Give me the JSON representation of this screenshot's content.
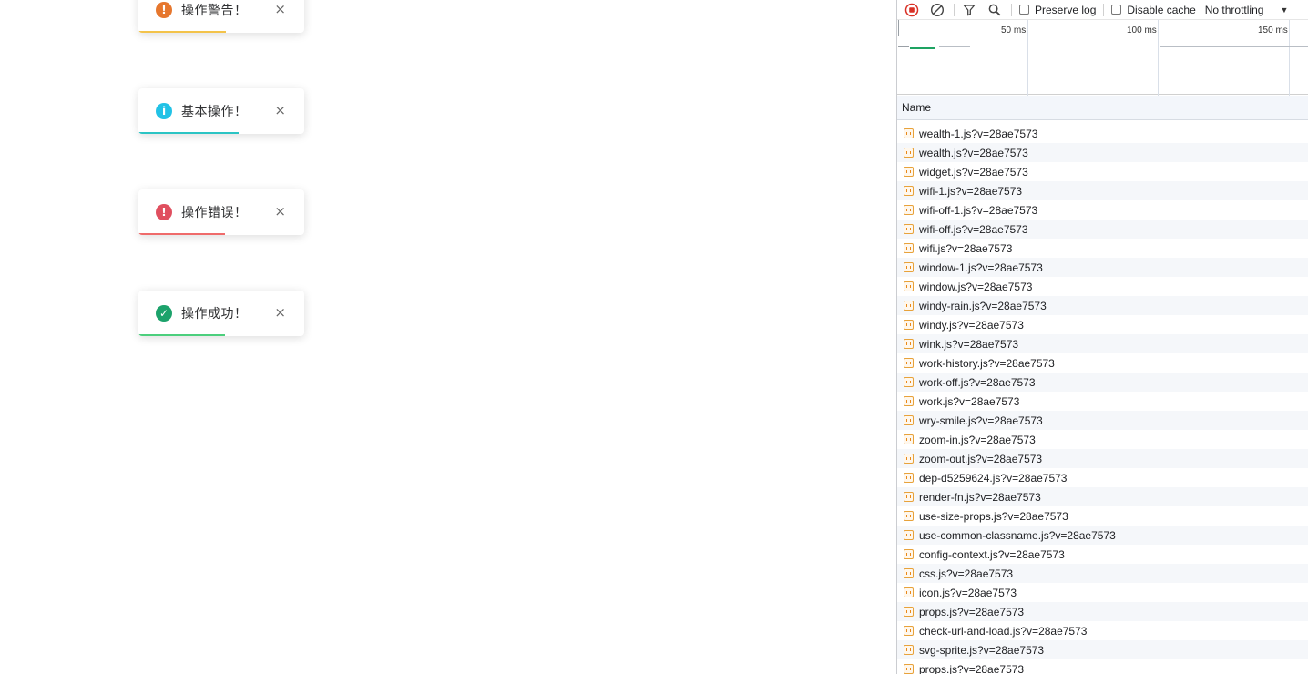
{
  "toasts": [
    {
      "text": "操作警告！",
      "type": "warning",
      "color": "#e6772e",
      "bar_color": "#f3c34a",
      "glyph": "!",
      "icon": "warning-icon",
      "progress_percent": 52
    },
    {
      "text": "基本操作！",
      "type": "info",
      "color": "#22c2e6",
      "bar_color": "#2bc4c4",
      "glyph": "i",
      "icon": "info-icon",
      "progress_percent": 60
    },
    {
      "text": "操作错误！",
      "type": "error",
      "color": "#e04f5f",
      "bar_color": "#ef6b6b",
      "glyph": "!",
      "icon": "error-icon",
      "progress_percent": 52
    },
    {
      "text": "操作成功！",
      "type": "success",
      "color": "#1ca26b",
      "bar_color": "#4ccf7d",
      "glyph": "✓",
      "icon": "success-icon",
      "progress_percent": 52
    }
  ],
  "toast_close": "×",
  "devtools": {
    "toolbar": {
      "record_icon": "record-stop-icon",
      "clear_icon": "clear-icon",
      "filter_icon": "filter-icon",
      "search_icon": "search-icon",
      "preserve_log": "Preserve log",
      "disable_cache": "Disable cache",
      "throttling": "No throttling",
      "throttle_caret": "▼"
    },
    "timeline": {
      "labels": [
        "50 ms",
        "100 ms",
        "150 ms"
      ]
    },
    "column_name": "Name",
    "files": [
      "wealth-1.js?v=28ae7573",
      "wealth.js?v=28ae7573",
      "widget.js?v=28ae7573",
      "wifi-1.js?v=28ae7573",
      "wifi-off-1.js?v=28ae7573",
      "wifi-off.js?v=28ae7573",
      "wifi.js?v=28ae7573",
      "window-1.js?v=28ae7573",
      "window.js?v=28ae7573",
      "windy-rain.js?v=28ae7573",
      "windy.js?v=28ae7573",
      "wink.js?v=28ae7573",
      "work-history.js?v=28ae7573",
      "work-off.js?v=28ae7573",
      "work.js?v=28ae7573",
      "wry-smile.js?v=28ae7573",
      "zoom-in.js?v=28ae7573",
      "zoom-out.js?v=28ae7573",
      "dep-d5259624.js?v=28ae7573",
      "render-fn.js?v=28ae7573",
      "use-size-props.js?v=28ae7573",
      "use-common-classname.js?v=28ae7573",
      "config-context.js?v=28ae7573",
      "css.js?v=28ae7573",
      "icon.js?v=28ae7573",
      "props.js?v=28ae7573",
      "check-url-and-load.js?v=28ae7573",
      "svg-sprite.js?v=28ae7573",
      "props.js?v=28ae7573"
    ]
  }
}
